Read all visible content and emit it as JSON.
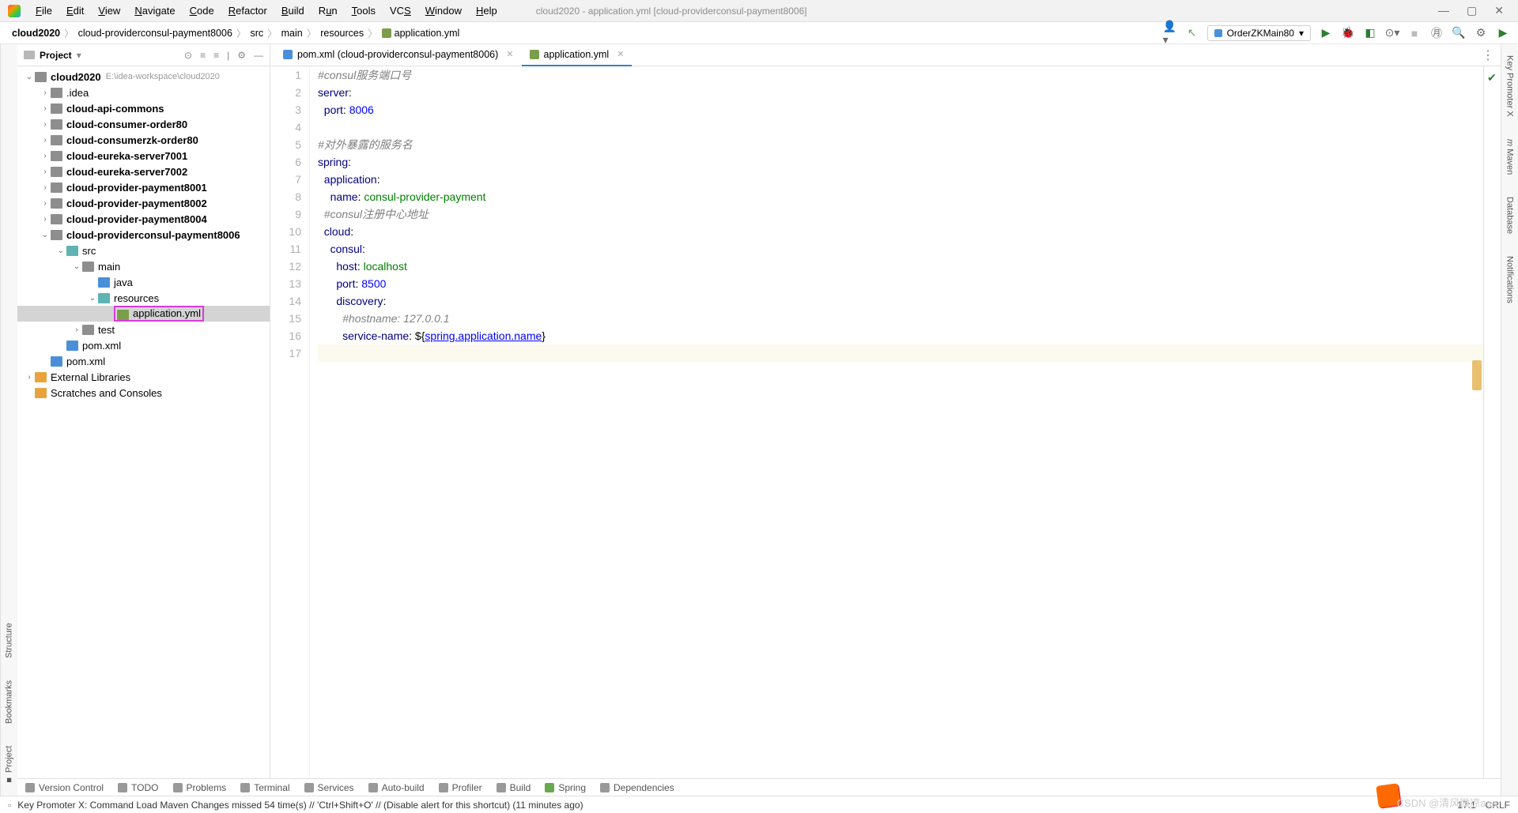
{
  "window_title": "cloud2020 - application.yml [cloud-providerconsul-payment8006]",
  "menu": [
    "File",
    "Edit",
    "View",
    "Navigate",
    "Code",
    "Refactor",
    "Build",
    "Run",
    "Tools",
    "VCS",
    "Window",
    "Help"
  ],
  "breadcrumb": [
    "cloud2020",
    "cloud-providerconsul-payment8006",
    "src",
    "main",
    "resources",
    "application.yml"
  ],
  "run_config": "OrderZKMain80",
  "project_panel": {
    "title": "Project"
  },
  "tree": {
    "root": {
      "name": "cloud2020",
      "path": "E:\\idea-workspace\\cloud2020"
    },
    "items": [
      ".idea",
      "cloud-api-commons",
      "cloud-consumer-order80",
      "cloud-consumerzk-order80",
      "cloud-eureka-server7001",
      "cloud-eureka-server7002",
      "cloud-provider-payment8001",
      "cloud-provider-payment8002",
      "cloud-provider-payment8004",
      "cloud-providerconsul-payment8006"
    ],
    "src_children": {
      "src": "src",
      "main": "main",
      "java": "java",
      "resources": "resources",
      "application": "application.yml",
      "test": "test",
      "pom1": "pom.xml",
      "pom2": "pom.xml"
    },
    "external": "External Libraries",
    "scratches": "Scratches and Consoles"
  },
  "editor_tabs": [
    {
      "label": "pom.xml (cloud-providerconsul-payment8006)",
      "icon": "m",
      "active": false
    },
    {
      "label": "application.yml",
      "icon": "y",
      "active": true
    }
  ],
  "code": {
    "l1": "#consul服务端口号",
    "l2k": "server",
    "l2c": ":",
    "l3k": "port",
    "l3c": ": ",
    "l3v": "8006",
    "l5": "#对外暴露的服务名",
    "l6k": "spring",
    "l6c": ":",
    "l7k": "application",
    "l7c": ":",
    "l8k": "name",
    "l8c": ": ",
    "l8v": "consul-provider-payment",
    "l9": "#consul注册中心地址",
    "l10k": "cloud",
    "l10c": ":",
    "l11k": "consul",
    "l11c": ":",
    "l12k": "host",
    "l12c": ": ",
    "l12v": "localhost",
    "l13k": "port",
    "l13c": ": ",
    "l13v": "8500",
    "l14k": "discovery",
    "l14c": ":",
    "l15": "#hostname: 127.0.0.1",
    "l16k": "service-name",
    "l16c": ": ${",
    "l16v": "spring.application.name",
    "l16e": "}"
  },
  "bottom_tools": [
    "Version Control",
    "TODO",
    "Problems",
    "Terminal",
    "Services",
    "Auto-build",
    "Profiler",
    "Build",
    "Spring",
    "Dependencies"
  ],
  "status_msg": "Key Promoter X: Command Load Maven Changes missed 54 time(s) // 'Ctrl+Shift+O' // (Disable alert for this shortcut) (11 minutes ago)",
  "status_right": {
    "pos": "17:1",
    "enc": "CRLF"
  },
  "left_rail": [
    "Project",
    "Bookmarks",
    "Structure"
  ],
  "right_rail": [
    "Key Promoter X",
    "Maven",
    "Database",
    "Notifications"
  ],
  "watermark": "CSDN @清风微凉aaa"
}
